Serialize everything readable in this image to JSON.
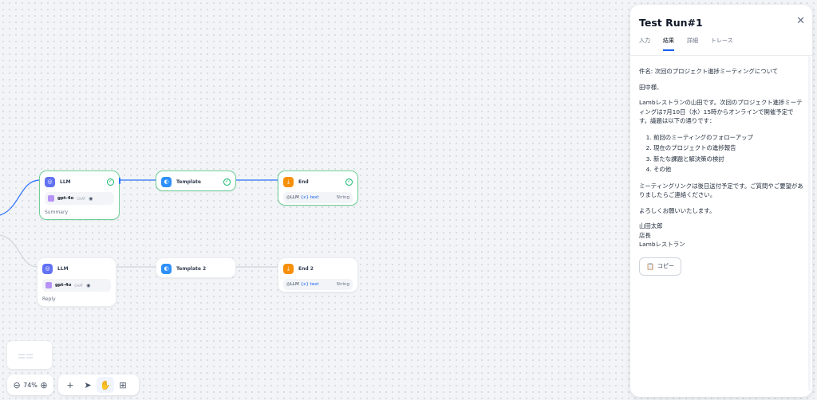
{
  "workflow": {
    "nodes": {
      "llm1": {
        "title": "LLM",
        "model": "gpt-4o",
        "model_tag": "CHAT",
        "footer": "Summary",
        "status": "success"
      },
      "template1": {
        "title": "Template",
        "status": "success"
      },
      "end1": {
        "title": "End",
        "output_source": "LLM",
        "output_var": "{x} text",
        "output_type": "String",
        "status": "success"
      },
      "llm2": {
        "title": "LLM",
        "model": "gpt-4o",
        "model_tag": "CHAT",
        "footer": "Reply"
      },
      "template2": {
        "title": "Template 2"
      },
      "end2": {
        "title": "End 2",
        "output_source": "LLM",
        "output_var": "{x} text",
        "output_type": "String"
      }
    },
    "edge_colors": {
      "active": "#2970ff",
      "inactive": "#d0d5dd"
    }
  },
  "toolbar": {
    "zoom_level": "74%",
    "icons": [
      "zoom-out-icon",
      "zoom-in-icon",
      "add-icon",
      "pointer-icon",
      "hand-icon",
      "organize-icon"
    ]
  },
  "panel": {
    "title": "Test Run#1",
    "tabs": [
      {
        "label": "入力"
      },
      {
        "label": "結果",
        "active": true
      },
      {
        "label": "詳細"
      },
      {
        "label": "トレース"
      }
    ],
    "result": {
      "subject": "件名: 次回のプロジェクト進捗ミーティングについて",
      "greeting": "田中様、",
      "body": "Lambレストランの山田です。次回のプロジェクト進捗ミーティングは7月10日（水）15時からオンラインで開催予定です。議題は以下の通りです：",
      "agenda": [
        "前回のミーティングのフォローアップ",
        "現在のプロジェクトの進捗報告",
        "新たな課題と解決策の検討",
        "その他"
      ],
      "note": "ミーティングリンクは後日送付予定です。ご質問やご要望がありましたらご連絡ください。",
      "closing": "よろしくお願いいたします。",
      "signature": [
        "山田太郎",
        "店長",
        "Lambレストラン"
      ]
    },
    "copy_label": "コピー"
  },
  "colors": {
    "accent": "#155eef",
    "success": "#12b76a",
    "llm_icon": "#6172f3",
    "template_icon": "#2e90fa",
    "end_icon": "#f79009"
  }
}
